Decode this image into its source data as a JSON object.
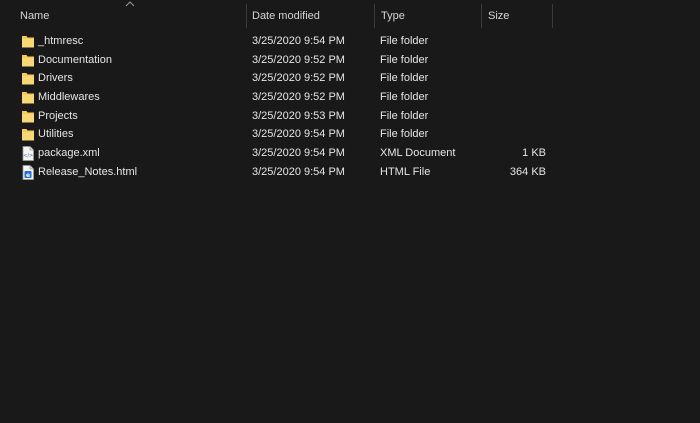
{
  "columns": {
    "name": "Name",
    "date_modified": "Date modified",
    "type": "Type",
    "size": "Size"
  },
  "files": [
    {
      "name": "_htmresc",
      "date": "3/25/2020 9:54 PM",
      "type": "File folder",
      "size": "",
      "icon": "folder-icon"
    },
    {
      "name": "Documentation",
      "date": "3/25/2020 9:52 PM",
      "type": "File folder",
      "size": "",
      "icon": "folder-icon"
    },
    {
      "name": "Drivers",
      "date": "3/25/2020 9:52 PM",
      "type": "File folder",
      "size": "",
      "icon": "folder-icon"
    },
    {
      "name": "Middlewares",
      "date": "3/25/2020 9:52 PM",
      "type": "File folder",
      "size": "",
      "icon": "folder-icon"
    },
    {
      "name": "Projects",
      "date": "3/25/2020 9:53 PM",
      "type": "File folder",
      "size": "",
      "icon": "folder-icon"
    },
    {
      "name": "Utilities",
      "date": "3/25/2020 9:54 PM",
      "type": "File folder",
      "size": "",
      "icon": "folder-icon"
    },
    {
      "name": "package.xml",
      "date": "3/25/2020 9:54 PM",
      "type": "XML Document",
      "size": "1 KB",
      "icon": "xml-file-icon"
    },
    {
      "name": "Release_Notes.html",
      "date": "3/25/2020 9:54 PM",
      "type": "HTML File",
      "size": "364 KB",
      "icon": "html-file-icon"
    }
  ],
  "colors": {
    "background": "#191919",
    "folder": "#f6cc57",
    "header_text": "#d6d6d6",
    "row_text": "#e6e6e6"
  }
}
